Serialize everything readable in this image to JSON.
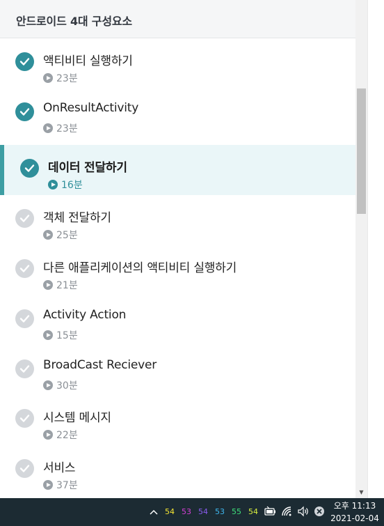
{
  "section": {
    "title": "안드로이드 4대 구성요소"
  },
  "lessons": [
    {
      "title": "액티비티 실행하기",
      "duration": "23분",
      "completed": true,
      "active": false
    },
    {
      "title": "OnResultActivity",
      "duration": "23분",
      "completed": true,
      "active": false
    },
    {
      "title": "데이터 전달하기",
      "duration": "16분",
      "completed": true,
      "active": true
    },
    {
      "title": "객체 전달하기",
      "duration": "25분",
      "completed": false,
      "active": false
    },
    {
      "title": "다른 애플리케이션의 액티비티 실행하기",
      "duration": "21분",
      "completed": false,
      "active": false
    },
    {
      "title": "Activity Action",
      "duration": "15분",
      "completed": false,
      "active": false
    },
    {
      "title": "BroadCast Reciever",
      "duration": "30분",
      "completed": false,
      "active": false
    },
    {
      "title": "시스템 메시지",
      "duration": "22분",
      "completed": false,
      "active": false
    },
    {
      "title": "서비스",
      "duration": "37분",
      "completed": false,
      "active": false
    }
  ],
  "colors": {
    "accent": "#3d9ea3",
    "check_done": "#2f8f9a",
    "check_pending": "#d4d7db",
    "active_bg": "#eaf6f8",
    "taskbar": "#1c2b33"
  },
  "taskbar": {
    "tray_numbers": [
      {
        "value": "54",
        "color": "#f5e633"
      },
      {
        "value": "53",
        "color": "#d63fd6"
      },
      {
        "value": "54",
        "color": "#8a5cf0"
      },
      {
        "value": "53",
        "color": "#3fb8f0"
      },
      {
        "value": "55",
        "color": "#3fe07a"
      },
      {
        "value": "54",
        "color": "#d9f03f"
      }
    ],
    "icons": [
      "chevron-up-icon",
      "battery-icon",
      "wifi-icon",
      "volume-icon",
      "close-circle-icon"
    ],
    "time": "오후 11:13",
    "date": "2021-02-04"
  }
}
